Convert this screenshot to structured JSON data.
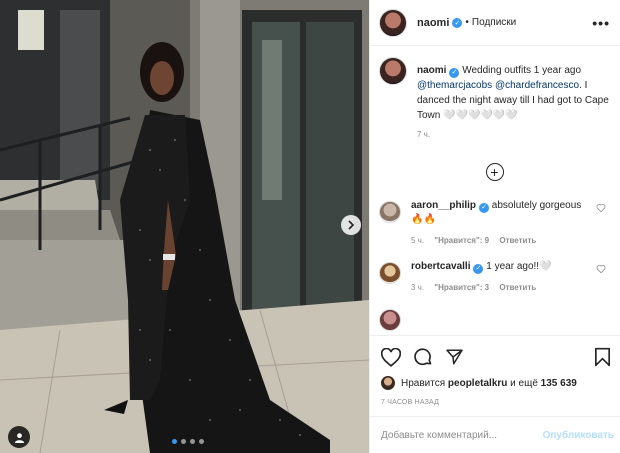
{
  "post": {
    "header": {
      "username": "naomi",
      "separator": "•",
      "follow_label": "Подписки",
      "more_label": "•••"
    },
    "caption": {
      "username": "naomi",
      "text_before": "Wedding outfits 1 year ago",
      "mention1": "@themarcjacobs",
      "mention2": "@chardefrancesco",
      "text_after": ". I danced the night away till I had got to Cape Town 🤍🤍🤍🤍🤍🤍",
      "time": "7 ч."
    },
    "load_more_label": "+",
    "comments": [
      {
        "username": "aaron__philip",
        "text": "absolutely gorgeous 🔥🔥",
        "time": "5 ч.",
        "likes": "\"Нравится\": 9",
        "reply": "Ответить"
      },
      {
        "username": "robertcavalli",
        "text": "1 year ago!!🤍",
        "time": "3 ч.",
        "likes": "\"Нравится\": 3",
        "reply": "Ответить"
      },
      {
        "username": "",
        "text": "",
        "time": "",
        "likes": "",
        "reply": ""
      }
    ],
    "likes": {
      "prefix": "Нравится",
      "user": "peopletalkru",
      "and_more": "и ещё",
      "count": "135 639"
    },
    "posted_time": "7 ЧАСОВ НАЗАД",
    "add_comment": {
      "placeholder": "Добавьте комментарий...",
      "post_label": "Опубликовать"
    },
    "photo": {
      "carousel_total": 4,
      "carousel_active": 1
    },
    "colors": {
      "accent": "#3897f0",
      "link": "#00376b",
      "muted": "#8e8e8e",
      "post_disabled": "#b2dffc"
    },
    "icons": [
      "verified-icon",
      "more-icon",
      "heart-icon",
      "comment-icon",
      "share-icon",
      "bookmark-icon",
      "chevron-right-icon",
      "user-tag-icon",
      "plus-circle-icon"
    ]
  }
}
